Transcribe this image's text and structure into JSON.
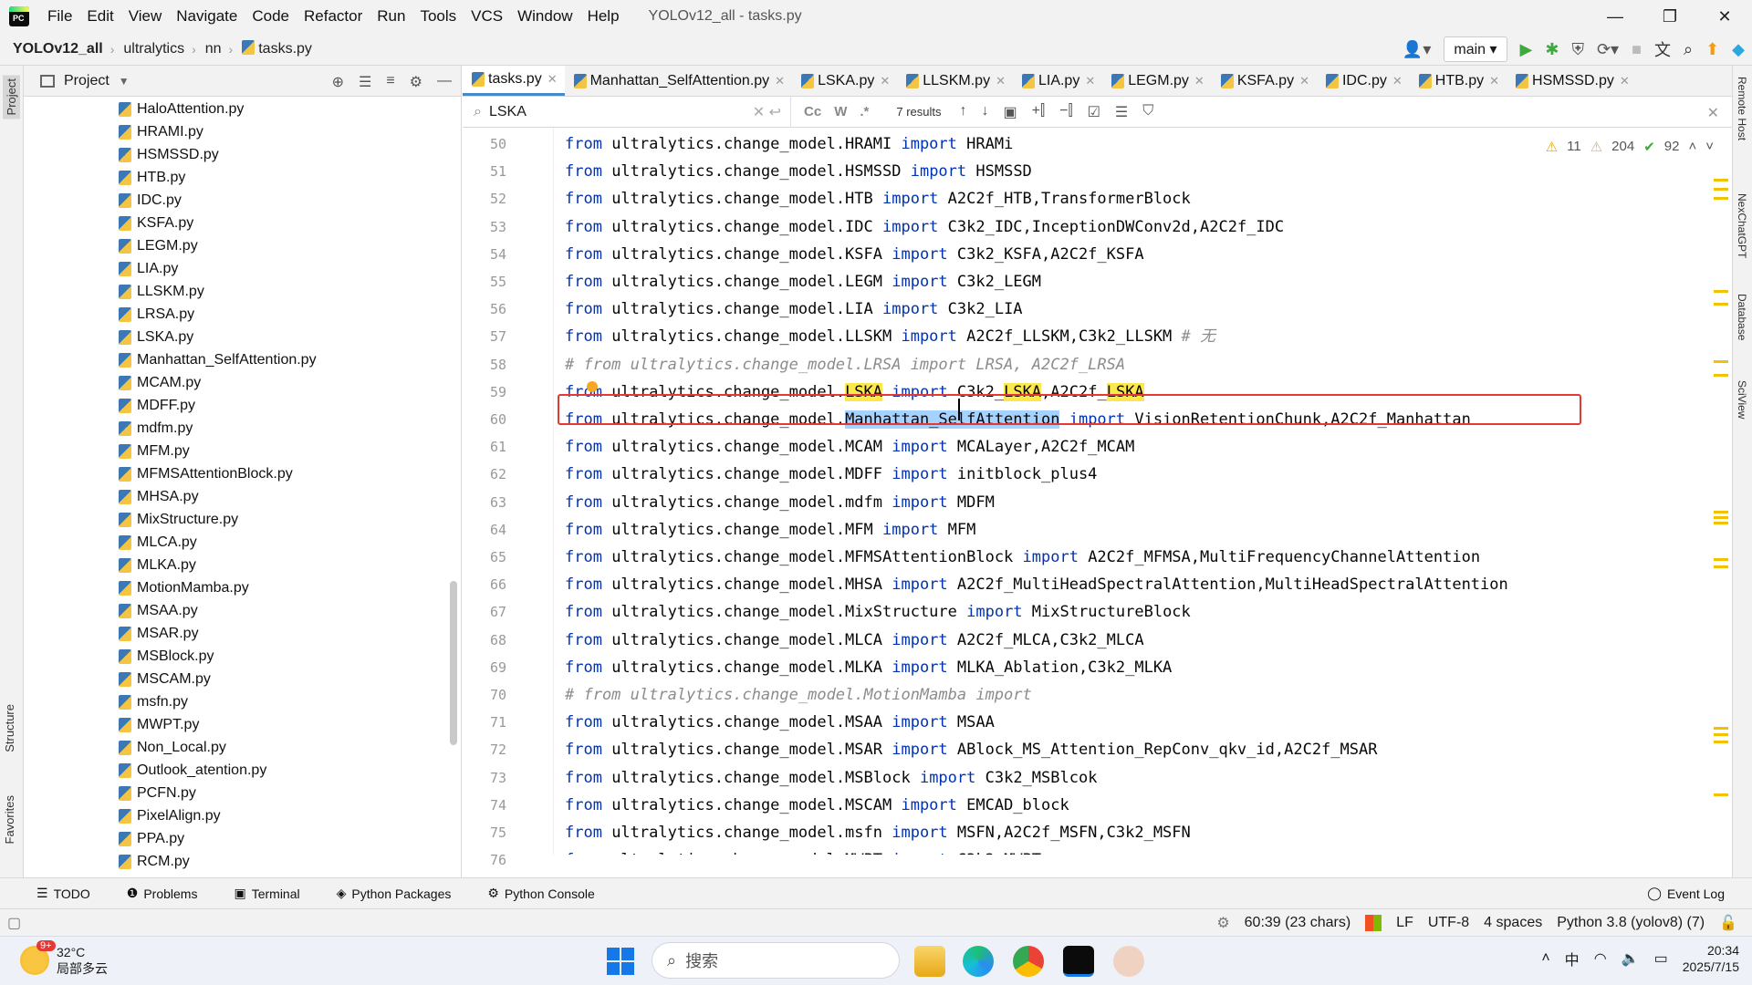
{
  "menubar": {
    "items": [
      "File",
      "Edit",
      "View",
      "Navigate",
      "Code",
      "Refactor",
      "Run",
      "Tools",
      "VCS",
      "Window",
      "Help"
    ],
    "title": "YOLOv12_all - tasks.py"
  },
  "window_controls": {
    "minimize": "—",
    "maximize": "❐",
    "close": "✕"
  },
  "navbar": {
    "project": "YOLOv12_all",
    "crumbs": [
      "ultralytics",
      "nn",
      "tasks.py"
    ],
    "branch": "main"
  },
  "project_panel": {
    "title": "Project",
    "files": [
      "HaloAttention.py",
      "HRAMI.py",
      "HSMSSD.py",
      "HTB.py",
      "IDC.py",
      "KSFA.py",
      "LEGM.py",
      "LIA.py",
      "LLSKM.py",
      "LRSA.py",
      "LSKA.py",
      "Manhattan_SelfAttention.py",
      "MCAM.py",
      "MDFF.py",
      "mdfm.py",
      "MFM.py",
      "MFMSAttentionBlock.py",
      "MHSA.py",
      "MixStructure.py",
      "MLCA.py",
      "MLKA.py",
      "MotionMamba.py",
      "MSAA.py",
      "MSAR.py",
      "MSBlock.py",
      "MSCAM.py",
      "msfn.py",
      "MWPT.py",
      "Non_Local.py",
      "Outlook_atention.py",
      "PCFN.py",
      "PixelAlign.py",
      "PPA.py",
      "RCM.py"
    ]
  },
  "tabs": [
    "tasks.py",
    "Manhattan_SelfAttention.py",
    "LSKA.py",
    "LLSKM.py",
    "LIA.py",
    "LEGM.py",
    "KSFA.py",
    "IDC.py",
    "HTB.py",
    "HSMSSD.py"
  ],
  "find": {
    "query": "LSKA",
    "results": "7 results",
    "opt_case": "Cc",
    "opt_word": "W",
    "opt_regex": ".*"
  },
  "inspections": {
    "warnings": "11",
    "weak": "204",
    "ok": "92"
  },
  "left_tools": [
    "Project",
    "Structure",
    "Favorites"
  ],
  "right_tools": [
    "Remote Host",
    "NexChatGPT",
    "Database",
    "SciView"
  ],
  "bottom_tabs": [
    "TODO",
    "Problems",
    "Terminal",
    "Python Packages",
    "Python Console"
  ],
  "event_log": "Event Log",
  "status": {
    "position": "60:39 (23 chars)",
    "line_sep": "LF",
    "encoding": "UTF-8",
    "indent": "4 spaces",
    "interpreter": "Python 3.8 (yolov8) (7)"
  },
  "taskbar": {
    "temp": "32°C",
    "weather": "局部多云",
    "badge": "9+",
    "search": "搜索",
    "ime": "中",
    "time": "20:34",
    "date": "2025/7/15"
  }
}
